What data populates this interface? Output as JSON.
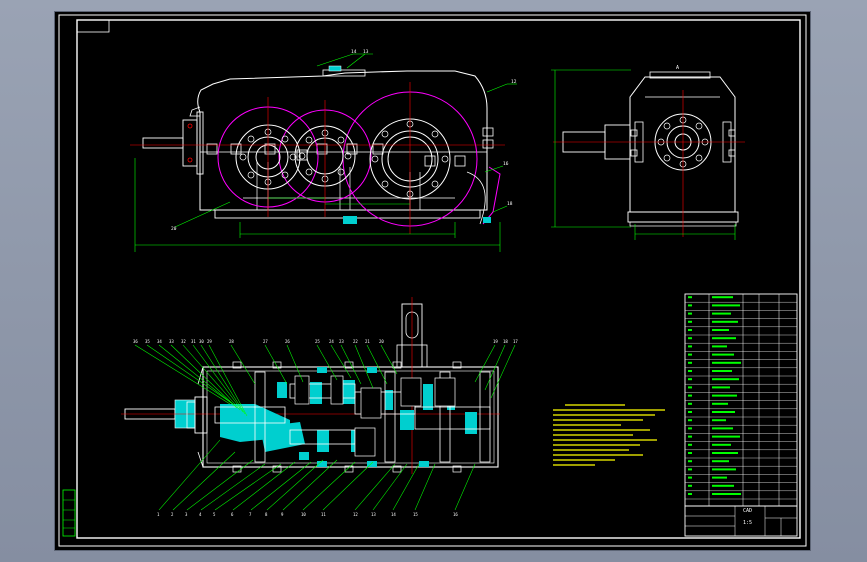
{
  "drawing": {
    "side_view_balloons": [
      "14",
      "13",
      "12",
      "16",
      "18",
      "20"
    ],
    "end_view_label": "A",
    "section_top_balloons": [
      "36",
      "35",
      "34",
      "33",
      "32",
      "31",
      "30",
      "29",
      "28",
      "27",
      "26",
      "25",
      "24",
      "23",
      "22",
      "21",
      "20",
      "19",
      "18",
      "17"
    ],
    "section_bottom_balloons": [
      "1",
      "2",
      "3",
      "4",
      "5",
      "6",
      "7",
      "8",
      "9",
      "10",
      "11",
      "12",
      "13",
      "14",
      "15",
      "16"
    ],
    "title_block_label": "CAD",
    "title_block_scale": "1:5"
  },
  "colors": {
    "background": "#000000",
    "frame": "#ffffff",
    "dimension": "#00ff00",
    "center_line": "#ff0000",
    "gear_circle": "#ff00ff",
    "section_fill": "#00cfcf",
    "notes": "#ffff00"
  }
}
